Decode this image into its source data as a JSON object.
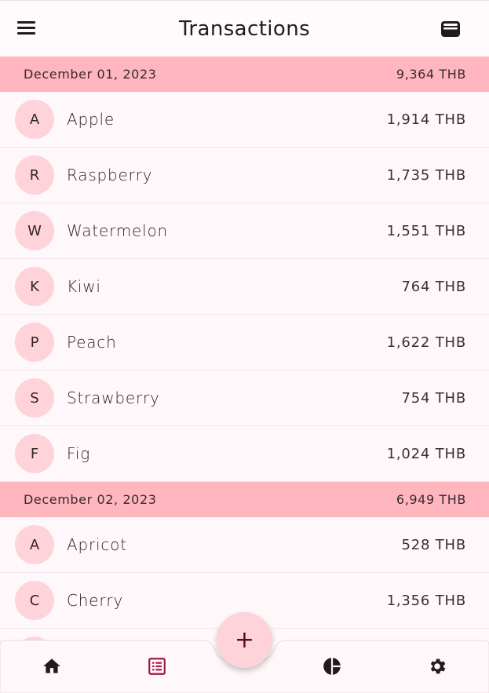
{
  "app_bar": {
    "title": "Transactions"
  },
  "groups": [
    {
      "date": "December 01, 2023",
      "total": "9,364 THB",
      "items": [
        {
          "initial": "A",
          "name": "Apple",
          "amount": "1,914 THB"
        },
        {
          "initial": "R",
          "name": "Raspberry",
          "amount": "1,735 THB"
        },
        {
          "initial": "W",
          "name": "Watermelon",
          "amount": "1,551 THB"
        },
        {
          "initial": "K",
          "name": "Kiwi",
          "amount": "764 THB"
        },
        {
          "initial": "P",
          "name": "Peach",
          "amount": "1,622 THB"
        },
        {
          "initial": "S",
          "name": "Strawberry",
          "amount": "754 THB"
        },
        {
          "initial": "F",
          "name": "Fig",
          "amount": "1,024 THB"
        }
      ]
    },
    {
      "date": "December 02, 2023",
      "total": "6,949 THB",
      "items": [
        {
          "initial": "A",
          "name": "Apricot",
          "amount": "528 THB"
        },
        {
          "initial": "C",
          "name": "Cherry",
          "amount": "1,356 THB"
        }
      ]
    }
  ],
  "fab": {
    "label": "+"
  },
  "bottom_nav": {
    "items": [
      {
        "icon": "home-icon",
        "active": false
      },
      {
        "icon": "list-icon",
        "active": true
      },
      {
        "icon": "pie-chart-icon",
        "active": false
      },
      {
        "icon": "gear-icon",
        "active": false
      }
    ]
  },
  "colors": {
    "header_band": "#ffb6bf",
    "avatar": "#ffd3d9",
    "active_nav": "#a0154a",
    "background": "#fff8fa"
  }
}
